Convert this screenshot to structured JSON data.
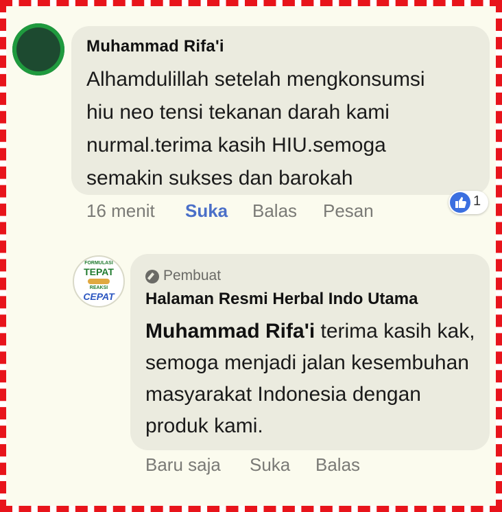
{
  "comment": {
    "author": "Muhammad Rifa'i",
    "text": "Alhamdulillah setelah mengkonsumsi\nhiu neo tensi tekanan darah kami\nnurmal.terima kasih HIU.semoga\nsemakin sukses dan barokah",
    "time": "16 menit",
    "like_label": "Suka",
    "reply_label": "Balas",
    "message_label": "Pesan",
    "reaction_count": "1",
    "colors": {
      "like_active": "#4a6fc8",
      "reaction": "#3b6fe0"
    }
  },
  "reply": {
    "badge_label": "Pembuat",
    "page_name": "Halaman Resmi Herbal Indo Utama",
    "mention": "Muhammad Rifa'i",
    "text": " terima kasih kak, semoga menjadi jalan kesembuhan masyarakat Indonesia dengan produk kami.",
    "time": "Baru saja",
    "like_label": "Suka",
    "reply_label": "Balas",
    "avatar": {
      "line1": "FORMULASI",
      "line2": "TEPAT",
      "line3": "REAKSI",
      "line4": "CEPAT"
    }
  },
  "frame_color": "#e8141b"
}
